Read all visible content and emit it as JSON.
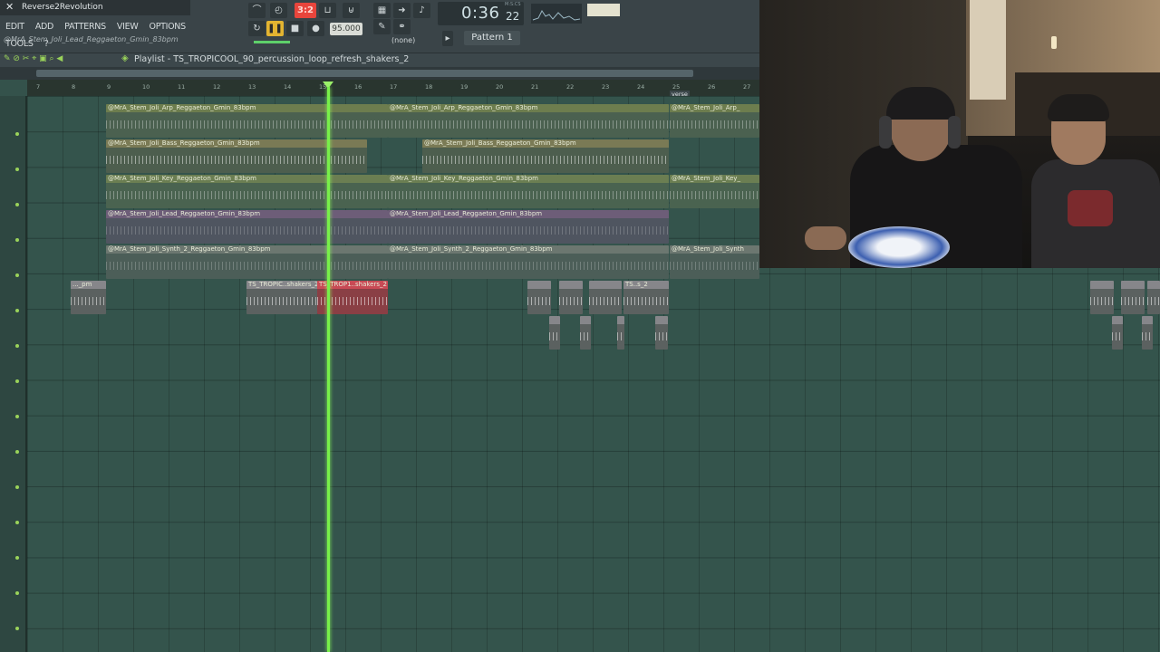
{
  "window": {
    "title": "Reverse2Revolution",
    "close_glyph": "✕"
  },
  "menu": [
    "EDIT",
    "ADD",
    "PATTERNS",
    "VIEW",
    "OPTIONS",
    "TOOLS",
    "?"
  ],
  "hint_text": "@MrA_Stem_Joli_Lead_Reggaeton_Gmin_83bpm",
  "transport": {
    "counter": "3:2",
    "tempo": "95.000",
    "time": "0:36",
    "time_frac": "22",
    "time_label": "M:S:CS",
    "none_label": "(none)",
    "pattern": "Pattern 1"
  },
  "playlist": {
    "title": "Playlist - TS_TROPICOOL_90_percussion_loop_refresh_shakers_2",
    "ruler": [
      "7",
      "8",
      "9",
      "10",
      "11",
      "12",
      "13",
      "14",
      "15",
      "16",
      "17",
      "18",
      "19",
      "20",
      "21",
      "22",
      "23",
      "24",
      "25",
      "26",
      "27"
    ],
    "marker": "verse"
  },
  "clips": {
    "arp": "@MrA_Stem_Joli_Arp_Reggaeton_Gmin_83bpm",
    "arp_cut": "@MrA_Stem_Joli_Arp_",
    "bass": "@MrA_Stem_Joli_Bass_Reggaeton_Gmin_83bpm",
    "key": "@MrA_Stem_Joli_Key_Reggaeton_Gmin_83bpm",
    "key_cut": "@MrA_Stem_Joli_Key_",
    "lead": "@MrA_Stem_Joli_Lead_Reggaeton_Gmin_83bpm",
    "synth": "@MrA_Stem_Joli_Synth_2_Reggaeton_Gmin_83bpm",
    "synth_cut": "@MrA_Stem_Joli_Synth",
    "pm": "..._pm",
    "shakers_a": "TS_TROPIC..shakers_2",
    "shakers_b": "TS_TROP1..shakers_2",
    "s2": "TS..s_2"
  },
  "colors": {
    "accent_green": "#78f04a",
    "record_red": "#e8453c"
  }
}
